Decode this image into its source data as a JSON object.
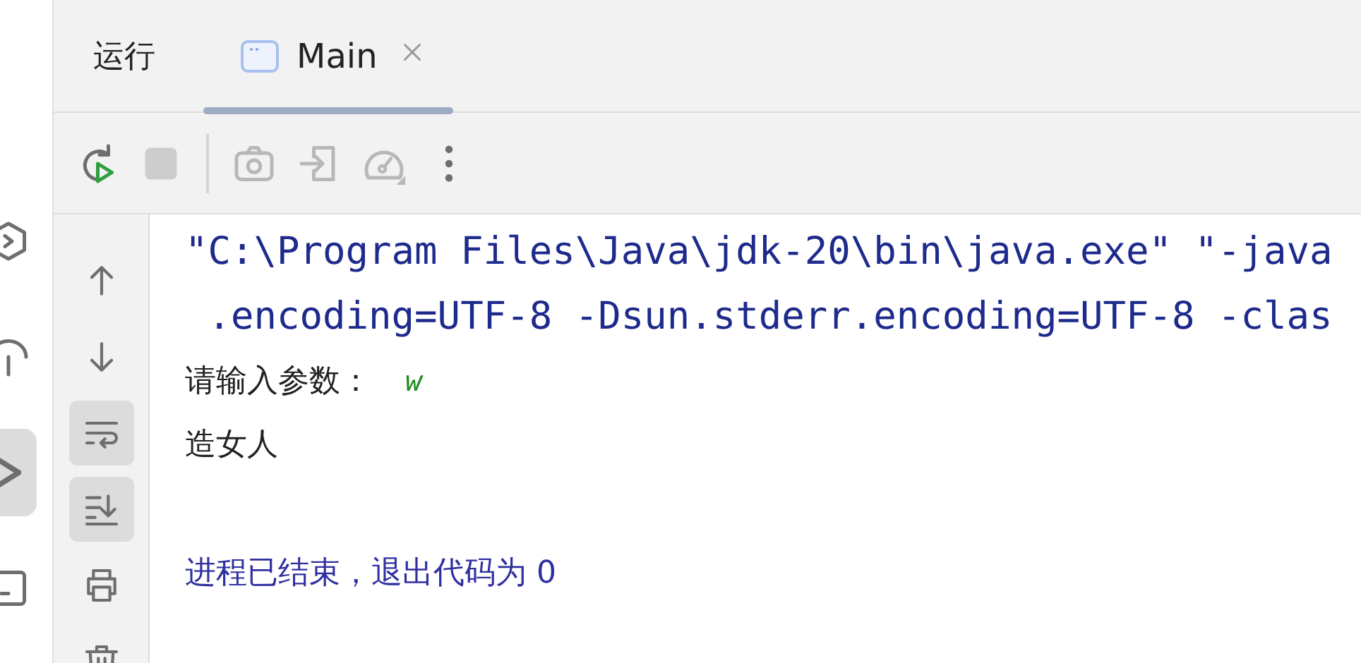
{
  "side_strip": [
    {
      "kind": "hexagon",
      "selected": false
    },
    {
      "kind": "umbrella",
      "selected": false
    },
    {
      "kind": "terminal",
      "selected": true
    },
    {
      "kind": "square",
      "selected": false
    }
  ],
  "panel": {
    "title": "运行",
    "tabs": [
      {
        "label": "Main",
        "selected": true,
        "closable": true
      }
    ]
  },
  "toolbar": [
    {
      "kind": "rerun"
    },
    {
      "kind": "stop",
      "disabled": true
    },
    {
      "kind": "separator"
    },
    {
      "kind": "camera",
      "disabled": true
    },
    {
      "kind": "enter",
      "disabled": true
    },
    {
      "kind": "gauge",
      "disabled": true
    },
    {
      "kind": "more"
    }
  ],
  "gutter": [
    {
      "kind": "up",
      "on": false
    },
    {
      "kind": "down",
      "on": false
    },
    {
      "kind": "wrap",
      "on": true
    },
    {
      "kind": "scroll-end",
      "on": true
    },
    {
      "kind": "print",
      "on": false
    },
    {
      "kind": "trash",
      "on": false
    }
  ],
  "console": [
    {
      "kind": "command",
      "text": "\"C:\\Program Files\\Java\\jdk-20\\bin\\java.exe\" \"-java"
    },
    {
      "kind": "command",
      "text": " .encoding=UTF-8 -Dsun.stderr.encoding=UTF-8 -clas"
    },
    {
      "kind": "prompt",
      "text": "请输入参数：",
      "input": "w"
    },
    {
      "kind": "output",
      "text": "造女人"
    },
    {
      "kind": "blank"
    },
    {
      "kind": "exit",
      "text": "进程已结束，退出代码为 0"
    }
  ]
}
